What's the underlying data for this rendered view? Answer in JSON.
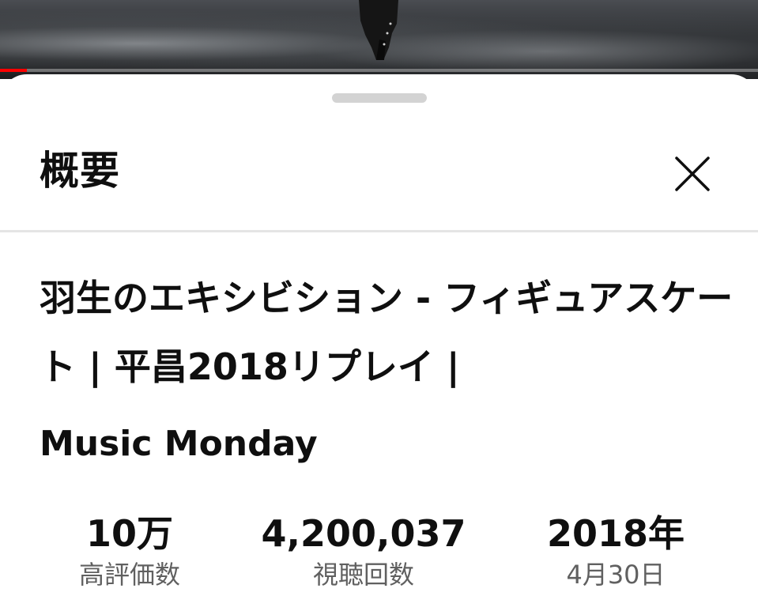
{
  "video": {
    "progress": 0.035,
    "progress_color": "#ff0000"
  },
  "sheet": {
    "title": "概要",
    "close_icon": "close-icon"
  },
  "description": {
    "video_title": "羽生のエキシビション - フィギュアスケート | 平昌2018リプレイ |",
    "channel": "Music Monday"
  },
  "stats": {
    "likes_value": "10万",
    "likes_label": "高評価数",
    "views_value": "4,200,037",
    "views_label": "視聴回数",
    "year_value": "2018年",
    "date_label": "4月30日"
  }
}
